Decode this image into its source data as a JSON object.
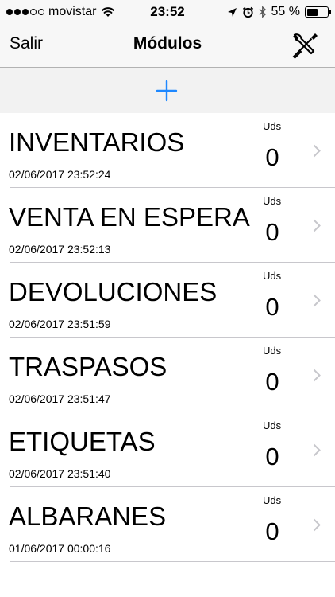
{
  "status_bar": {
    "carrier": "movistar",
    "time": "23:52",
    "battery_percent": "55 %",
    "battery_level": 0.55,
    "signal_bars_filled": 3,
    "signal_bars_total": 5
  },
  "nav": {
    "left_label": "Salir",
    "title": "Módulos",
    "right_icon": "tools-icon"
  },
  "add_bar": {
    "icon": "plus-icon",
    "accent_color": "#1e88ff"
  },
  "modules": [
    {
      "title": "INVENTARIOS",
      "date": "02/06/2017 23:52:24",
      "uds_label": "Uds",
      "count": "0"
    },
    {
      "title": "VENTA EN ESPERA",
      "date": "02/06/2017 23:52:13",
      "uds_label": "Uds",
      "count": "0"
    },
    {
      "title": "DEVOLUCIONES",
      "date": "02/06/2017 23:51:59",
      "uds_label": "Uds",
      "count": "0"
    },
    {
      "title": "TRASPASOS",
      "date": "02/06/2017 23:51:47",
      "uds_label": "Uds",
      "count": "0"
    },
    {
      "title": "ETIQUETAS",
      "date": "02/06/2017 23:51:40",
      "uds_label": "Uds",
      "count": "0"
    },
    {
      "title": "ALBARANES",
      "date": "01/06/2017 00:00:16",
      "uds_label": "Uds",
      "count": "0"
    }
  ]
}
